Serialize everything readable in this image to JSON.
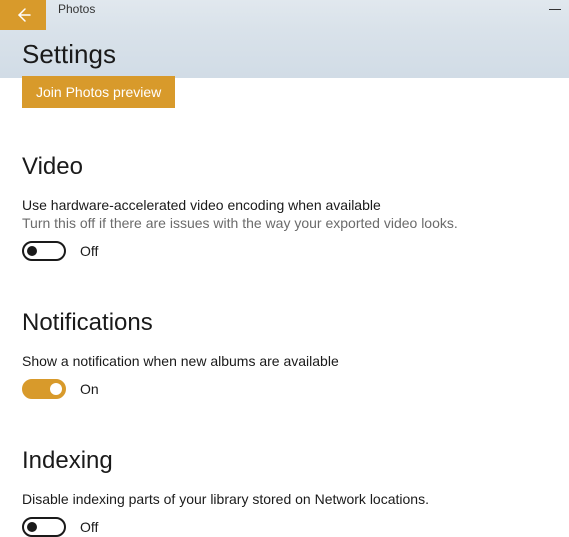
{
  "titlebar": {
    "app_name": "Photos"
  },
  "header": {
    "page_title": "Settings"
  },
  "preview": {
    "join_button": "Join Photos preview"
  },
  "video": {
    "heading": "Video",
    "setting_title": "Use hardware-accelerated video encoding when available",
    "setting_desc": "Turn this off if there are issues with the way your exported video looks.",
    "toggle_state": "Off"
  },
  "notifications": {
    "heading": "Notifications",
    "setting_title": "Show a notification when new albums are available",
    "toggle_state": "On"
  },
  "indexing": {
    "heading": "Indexing",
    "setting_title": "Disable indexing parts of your library stored on Network locations.",
    "toggle_state": "Off"
  }
}
